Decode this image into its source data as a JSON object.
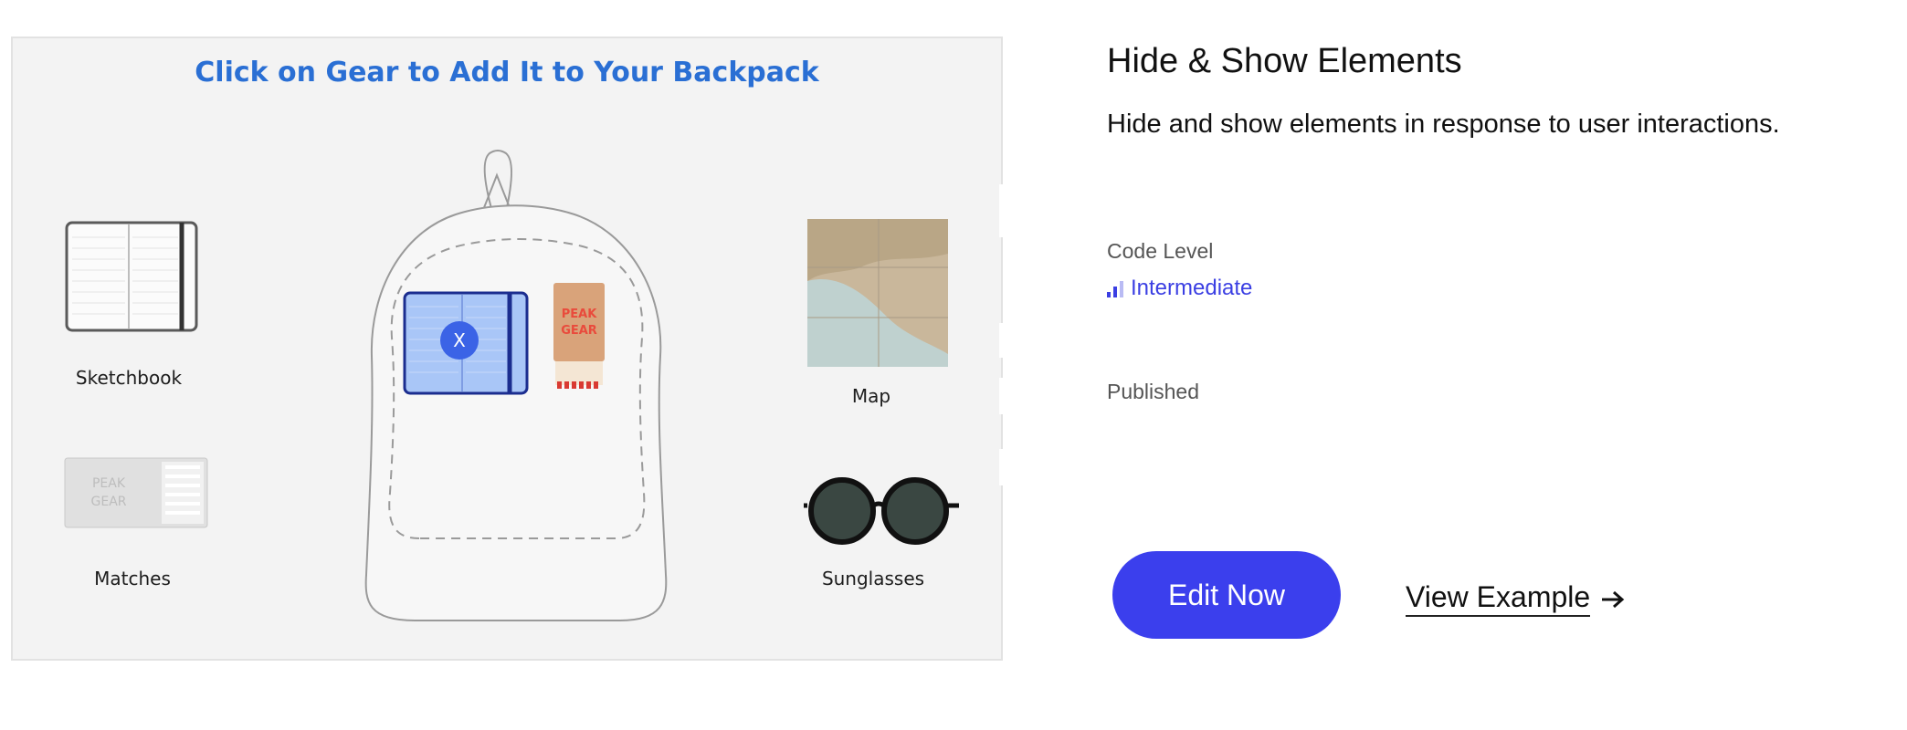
{
  "preview": {
    "heading": "Click on Gear to Add It to Your Backpack",
    "items": {
      "sketchbook": "Sketchbook",
      "matches": "Matches",
      "map": "Map",
      "sunglasses": "Sunglasses"
    },
    "added_item": {
      "remove_label": "X"
    },
    "matchbox_brand": {
      "line1": "PEAK",
      "line2": "GEAR"
    }
  },
  "info": {
    "title": "Hide & Show Elements",
    "description": "Hide and show elements in response to user interactions.",
    "code_level_label": "Code Level",
    "code_level_value": "Intermediate",
    "status": "Published"
  },
  "actions": {
    "edit_now": "Edit Now",
    "view_example": "View Example",
    "view_example_icon": "arrow-right-icon"
  },
  "colors": {
    "accent": "#3b3fed",
    "heading_blue": "#2a6fd4",
    "preview_bg": "#f3f3f3"
  }
}
